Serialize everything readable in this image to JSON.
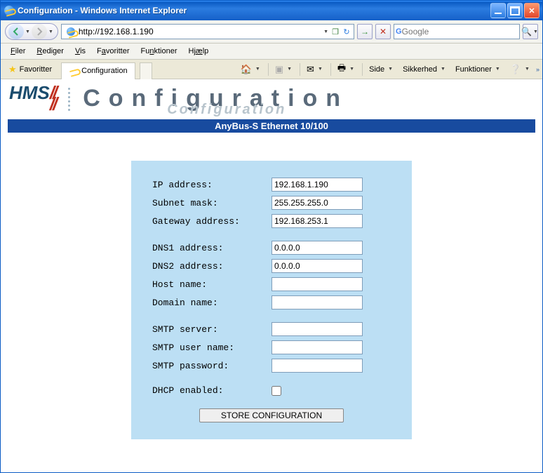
{
  "window": {
    "title": "Configuration - Windows Internet Explorer"
  },
  "address": {
    "url": "http://192.168.1.190"
  },
  "search": {
    "placeholder": "Google"
  },
  "menubar": {
    "items": [
      "Filer",
      "Rediger",
      "Vis",
      "Favoritter",
      "Funktioner",
      "Hjælp"
    ],
    "underline_index": [
      0,
      0,
      0,
      1,
      2,
      2
    ]
  },
  "toolbar": {
    "favorites_label": "Favoritter",
    "tab_label": "Configuration",
    "side_label": "Side",
    "sikkerhed_label": "Sikkerhed",
    "funktioner_label": "Funktioner"
  },
  "page": {
    "heading": "Configuration",
    "heading_shadow": "Configuration",
    "bluebar": "AnyBus-S Ethernet 10/100",
    "labels": {
      "ip": "IP address:",
      "subnet": "Subnet mask:",
      "gateway": "Gateway address:",
      "dns1": "DNS1 address:",
      "dns2": "DNS2 address:",
      "host": "Host name:",
      "domain": "Domain name:",
      "smtp_server": "SMTP server:",
      "smtp_user": "SMTP user name:",
      "smtp_pass": "SMTP password:",
      "dhcp": "DHCP enabled:"
    },
    "values": {
      "ip": "192.168.1.190",
      "subnet": "255.255.255.0",
      "gateway": "192.168.253.1",
      "dns1": "0.0.0.0",
      "dns2": "0.0.0.0",
      "host": "",
      "domain": "",
      "smtp_server": "",
      "smtp_user": "",
      "smtp_pass": "",
      "dhcp": false
    },
    "store_button": "STORE CONFIGURATION"
  }
}
